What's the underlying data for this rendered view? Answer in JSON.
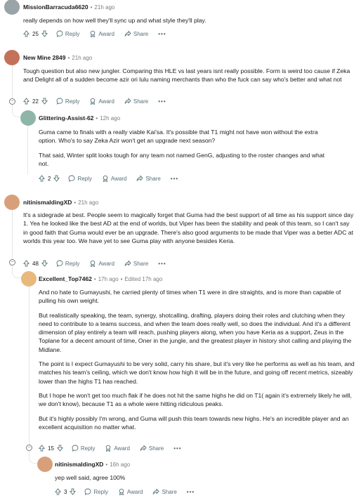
{
  "comments": [
    {
      "author": "MissionBarracuda6620",
      "time": "21h ago",
      "paragraphs": [
        "really depends on how well they'll sync up and what style they'll play."
      ],
      "votes": "25"
    },
    {
      "author": "New Mine 2849",
      "time": "21h ago",
      "paragraphs": [
        "Tough question but also new jungler. Comparing this HLE vs last years isnt really possible. Form is weird too cause if Zeka and Delight all of a sudden become azir ori lulu naming merchants than who the fuck can say who's better and what not"
      ],
      "votes": "22"
    },
    {
      "author": "Glittering-Assist-62",
      "time": "12h ago",
      "paragraphs": [
        "Guma came to finals with a really viable Kai'sa. It's possible that T1 might not have won without the extra option. Who's to say Zeka Azir won't get an upgrade next season?",
        "That said, Winter split looks tough for any team not named GenG, adjusting to the roster changes and what not."
      ],
      "votes": "2"
    },
    {
      "author": "nitinismaldingXD",
      "time": "21h ago",
      "paragraphs": [
        "It's a sidegrade at best. People seem to magically forget that Guma had the best support of all time as his support since day 1. Yea he looked like the best AD at the end of worlds, but Viper has been the stability and peak of this team, so I can't say in good faith that Guma would ever be an upgrade. There's also good arguments to be made that Viper was a better ADC at worlds this year too. We have yet to see Guma play with anyone besides Keria."
      ],
      "votes": "48"
    },
    {
      "author": "Excellent_Top7462",
      "time": "17h ago",
      "edited": "Edited 17h ago",
      "paragraphs": [
        "And no hate to Gumayushi, he carried plenty of times when T1 were in dire straights, and is more than capable of pulling his own weight.",
        "But realistically speaking, the team, synergy, shotcalling, drafting, players doing their roles and clutching when they need to contribute to a teams success, and when the team does really well, so does the individual. And it's a different dimension of play entirely a team will reach, pushing players along, when you have Keria as a support, Zeus in the Toplane for a decent amount of time, Oner in the jungle, and the greatest player in history shot calling and playing the Midlane.",
        "The point is I expect Gumayushi to be very solid, carry his share, but it's very like he performs as well as his team, and matches his team's ceiling, which we don't know how high it will be in the future, and going off recent metrics, sizeably lower than the highs T1 has reached.",
        "But I hope he won't get too much flak if he does not hit the same highs he did on T1( again it's extremely likely he will, we don't know), because T1 as a whole were hitting ridiculous peaks.",
        "But it's highly possibly I'm wrong, and Guma will push this team towards new highs. He's an incredible player and an excellent acquisition no matter what."
      ],
      "votes": "15"
    },
    {
      "author": "nitinismaldingXD",
      "time": "16h ago",
      "paragraphs": [
        "yep well said, agree 100%"
      ],
      "votes": "3"
    }
  ],
  "actions": {
    "reply": "Reply",
    "award": "Award",
    "share": "Share",
    "more": "•••",
    "collapse": "−"
  },
  "icons": {
    "upvote": "upvote-arrow-icon",
    "downvote": "downvote-arrow-icon",
    "reply": "speech-bubble-icon",
    "award": "award-medal-icon",
    "share": "share-arrow-icon"
  },
  "colors": {
    "text": "#1c1c1c",
    "meta": "#7c7c7c",
    "action": "#576f76",
    "thread_line": "#e5e7e8"
  }
}
